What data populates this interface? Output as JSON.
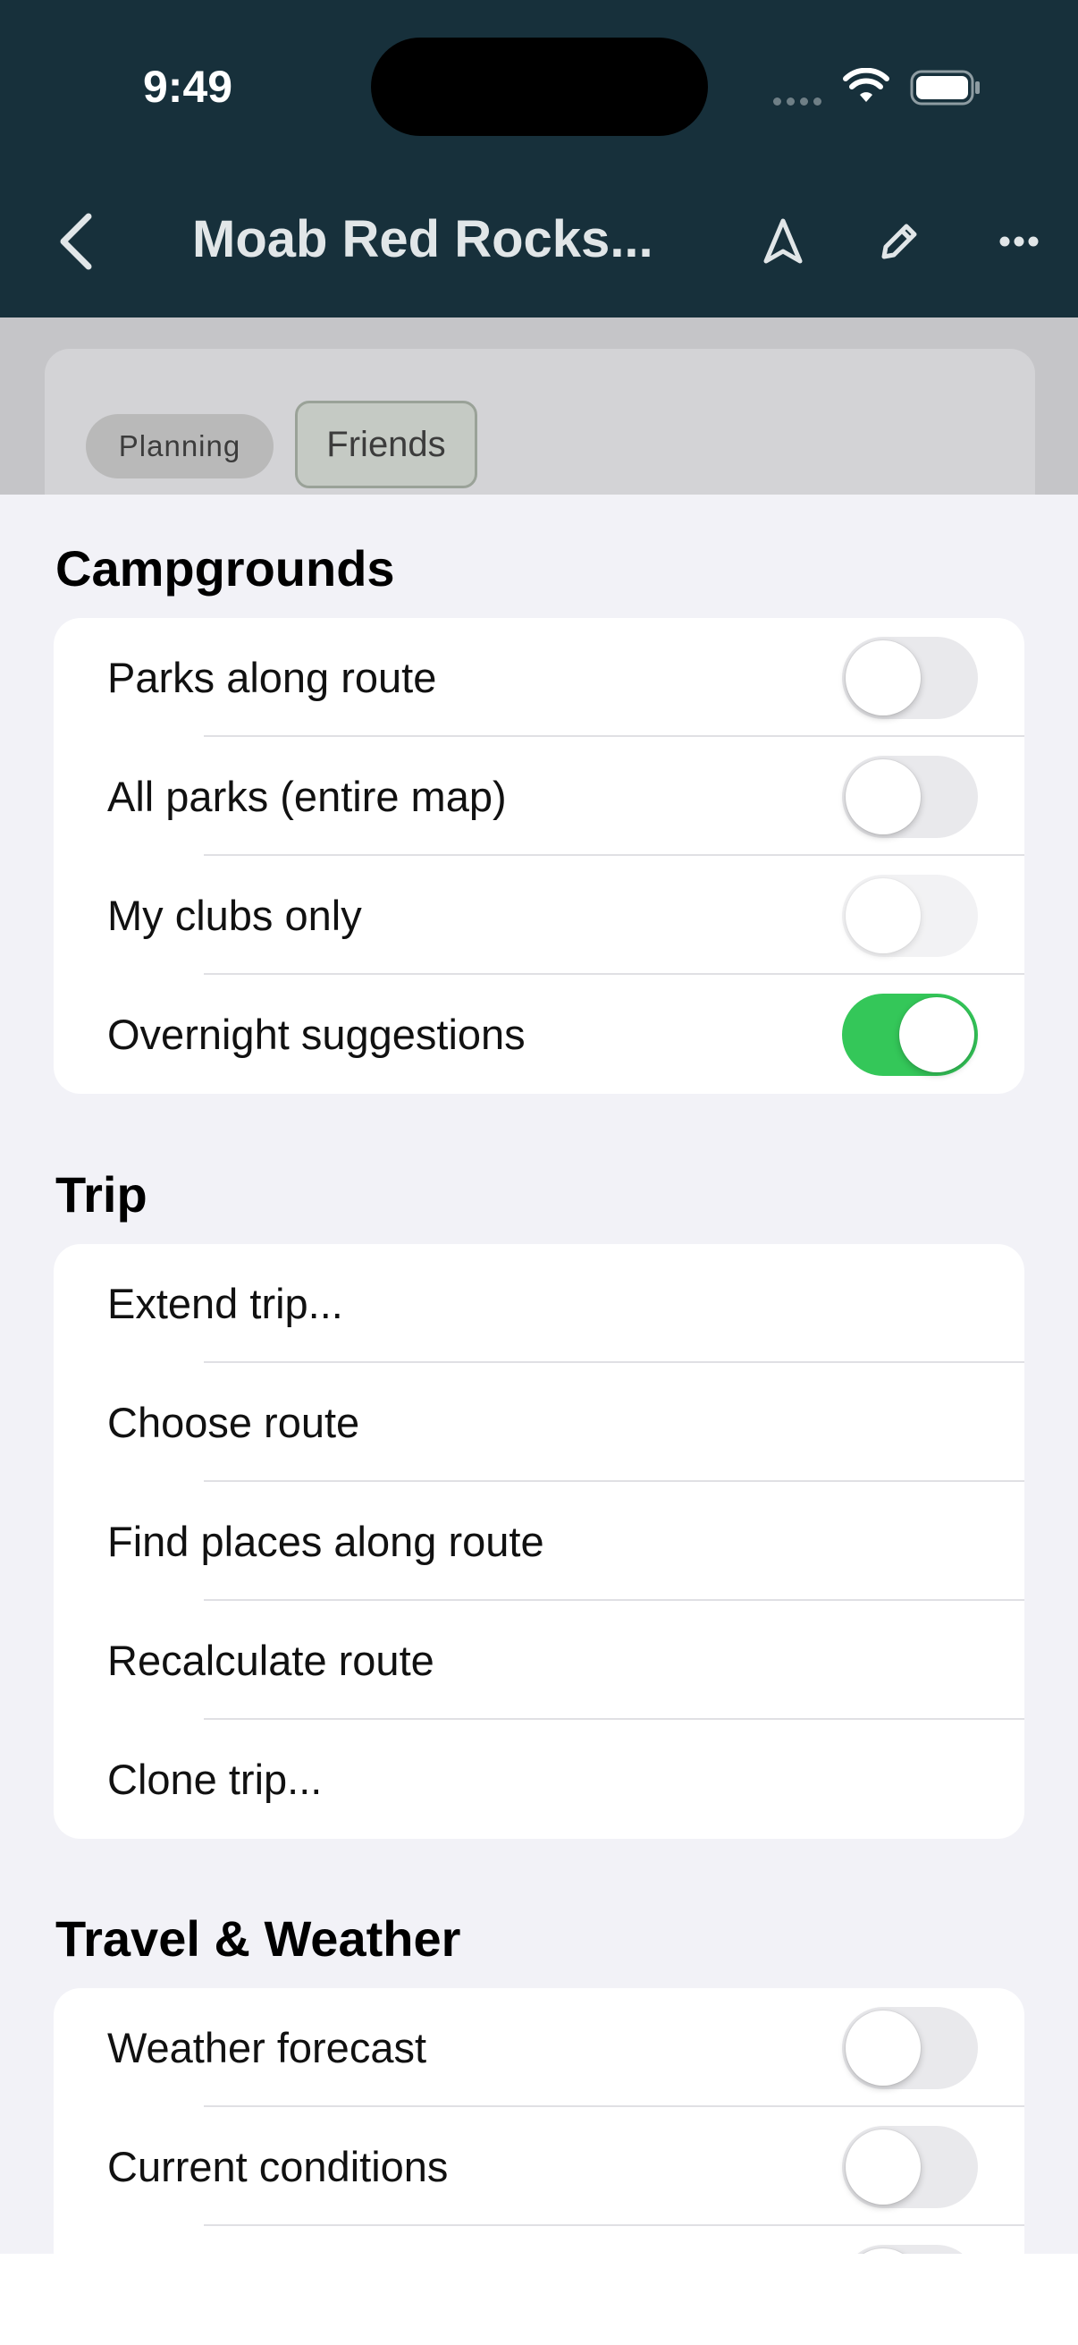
{
  "status_bar": {
    "time": "9:49"
  },
  "nav": {
    "title": "Moab Red Rocks..."
  },
  "chips": {
    "planning": "Planning",
    "friends": "Friends"
  },
  "sections": {
    "campgrounds": {
      "title": "Campgrounds",
      "rows": [
        {
          "label": "Parks along route",
          "toggle": "off"
        },
        {
          "label": "All parks (entire map)",
          "toggle": "off"
        },
        {
          "label": "My clubs only",
          "toggle": "off-disabled"
        },
        {
          "label": "Overnight suggestions",
          "toggle": "on"
        }
      ]
    },
    "trip": {
      "title": "Trip",
      "rows": [
        {
          "label": "Extend trip..."
        },
        {
          "label": "Choose route"
        },
        {
          "label": "Find places along route"
        },
        {
          "label": "Recalculate route"
        },
        {
          "label": "Clone trip..."
        }
      ]
    },
    "travel_weather": {
      "title": "Travel & Weather",
      "rows": [
        {
          "label": "Weather forecast",
          "toggle": "off"
        },
        {
          "label": "Current conditions",
          "toggle": "off"
        },
        {
          "label": "",
          "toggle": "off"
        }
      ]
    }
  },
  "colors": {
    "header_bg": "#17303b",
    "toggle_on": "#34c759",
    "sheet_bg": "#f2f2f7"
  },
  "icons": [
    "back-chevron-icon",
    "navigation-arrow-icon",
    "pencil-icon",
    "more-dots-icon",
    "wifi-icon",
    "battery-icon",
    "signal-icon"
  ]
}
